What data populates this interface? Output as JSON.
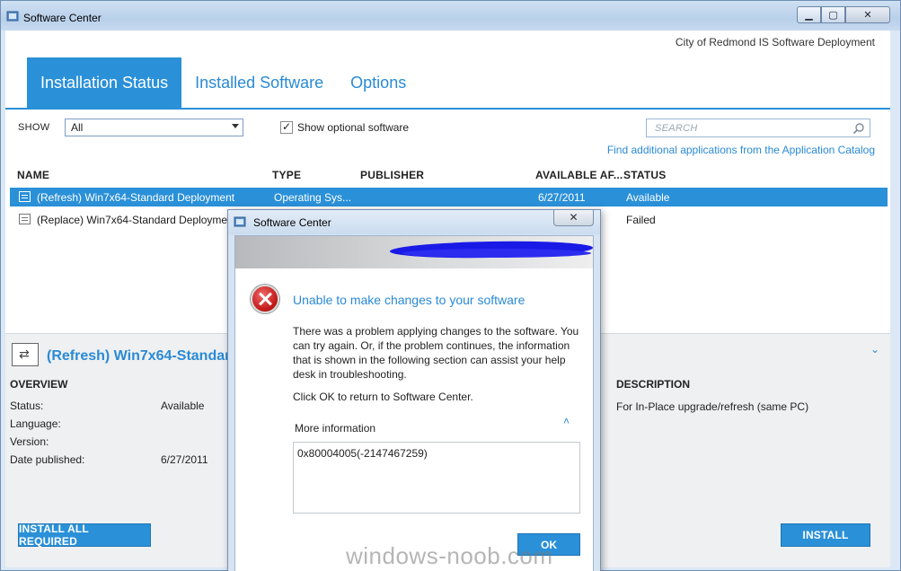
{
  "window": {
    "title": "Software Center",
    "buttons": {
      "minimize": "▁",
      "maximize": "▢",
      "close": "✕"
    }
  },
  "header": {
    "brand": "City of Redmond IS Software Deployment",
    "tabs": [
      {
        "label": "Installation Status",
        "active": true
      },
      {
        "label": "Installed Software",
        "active": false
      },
      {
        "label": "Options",
        "active": false
      }
    ]
  },
  "filters": {
    "show_label": "SHOW",
    "show_value": "All",
    "optional_checked": true,
    "optional_label": "Show optional software",
    "check_mark": "✓",
    "search_placeholder": "SEARCH",
    "catalog_link": "Find additional applications from the Application Catalog"
  },
  "table": {
    "columns": [
      "NAME",
      "TYPE",
      "PUBLISHER",
      "AVAILABLE AF...",
      "STATUS"
    ],
    "rows": [
      {
        "name": "(Refresh) Win7x64-Standard Deployment",
        "type": "Operating Sys...",
        "publisher": "",
        "available": "6/27/2011",
        "status": "Available",
        "selected": true
      },
      {
        "name": "(Replace) Win7x64-Standard Deployment",
        "type": "",
        "publisher": "",
        "available": "",
        "status": "Failed",
        "selected": false
      }
    ]
  },
  "details": {
    "title": "(Refresh) Win7x64-Standar",
    "chevron": "⌄",
    "overview_heading": "OVERVIEW",
    "overview": [
      {
        "label": "Status:",
        "value": "Available"
      },
      {
        "label": "Language:",
        "value": ""
      },
      {
        "label": "Version:",
        "value": ""
      },
      {
        "label": "Date published:",
        "value": "6/27/2011"
      }
    ],
    "description_heading": "DESCRIPTION",
    "description": "For In-Place upgrade/refresh (same PC)",
    "install_all_label": "INSTALL ALL REQUIRED",
    "install_label": "INSTALL"
  },
  "dialog": {
    "title": "Software Center",
    "close": "✕",
    "heading": "Unable to make changes to your software",
    "message": "There was a problem applying changes to the software.  You can try again. Or, if the problem continues, the information that is shown in the following section can assist your help desk in troubleshooting.",
    "instruction": "Click OK to return to Software Center.",
    "more_info_label": "More information",
    "more_info_chevron": "˄",
    "error_code": "0x80004005(-2147467259)",
    "ok_label": "OK"
  },
  "watermark": "windows-noob.com",
  "colors": {
    "accent": "#2a90d8",
    "link": "#2a8ad4",
    "error": "#c31a1a"
  }
}
